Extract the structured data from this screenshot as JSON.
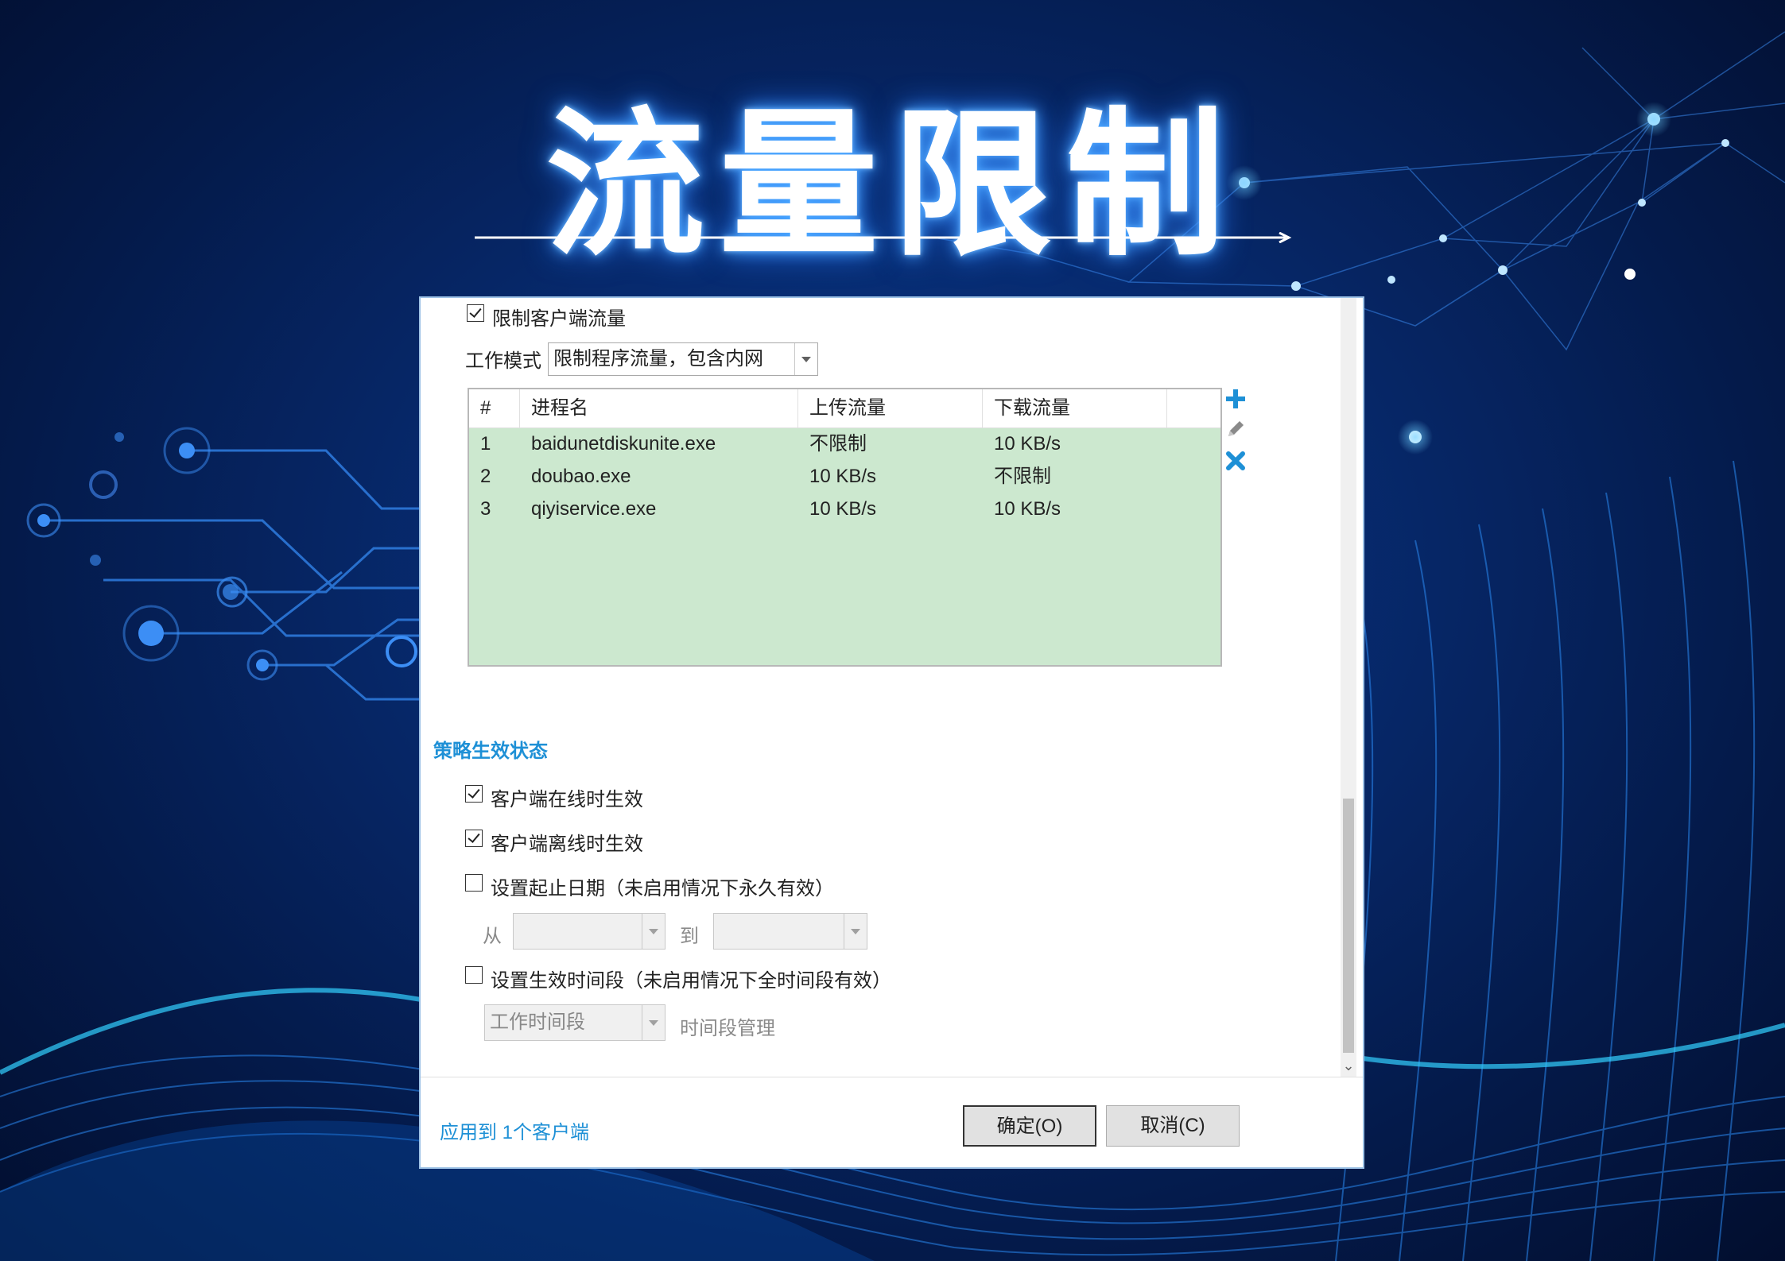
{
  "banner": {
    "title": "流量限制"
  },
  "dialog": {
    "limit_checkbox": {
      "label": "限制客户端流量",
      "checked": true
    },
    "mode": {
      "label": "工作模式",
      "value": "限制程序流量，包含内网"
    },
    "table": {
      "columns": [
        "#",
        "进程名",
        "上传流量",
        "下载流量"
      ],
      "rows": [
        {
          "no": "1",
          "name": "baidunetdiskunite.exe",
          "upload": "不限制",
          "download": "10 KB/s"
        },
        {
          "no": "2",
          "name": "doubao.exe",
          "upload": "10 KB/s",
          "download": "不限制"
        },
        {
          "no": "3",
          "name": "qiyiservice.exe",
          "upload": "10 KB/s",
          "download": "10 KB/s"
        }
      ],
      "row_bg": "#cce8cf"
    },
    "policy": {
      "title": "策略生效状态",
      "online": {
        "label": "客户端在线时生效",
        "checked": true
      },
      "offline": {
        "label": "客户端离线时生效",
        "checked": true
      },
      "date_range": {
        "label": "设置起止日期（未启用情况下永久有效）",
        "checked": false,
        "from_label": "从",
        "to_label": "到"
      },
      "time_range": {
        "label": "设置生效时间段（未启用情况下全时间段有效）",
        "checked": false,
        "select_value": "工作时间段",
        "manage_label": "时间段管理"
      }
    },
    "footer": {
      "apply_link": "应用到 1个客户端",
      "ok_label": "确定(O)",
      "cancel_label": "取消(C)"
    },
    "accent_color": "#1e90d6"
  }
}
